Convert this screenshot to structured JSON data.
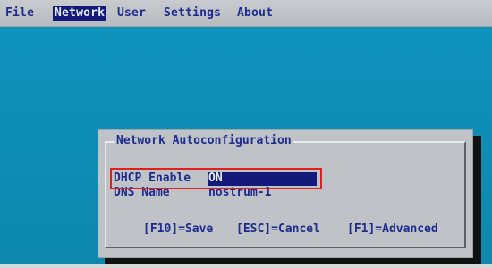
{
  "menu": {
    "items": [
      "File",
      "Network",
      "User",
      "Settings",
      "About"
    ],
    "active": "Network"
  },
  "dialog": {
    "title": "Network Autoconfiguration",
    "fields": [
      {
        "label": "DHCP Enable",
        "value": "ON"
      },
      {
        "label": "DNS Name",
        "value": "nostrum-1"
      }
    ],
    "keys": {
      "save": "[F10]=Save",
      "cancel": "[ESC]=Cancel",
      "advanced": "[F1]=Advanced"
    }
  },
  "colors": {
    "background": "#0f8fb8",
    "menubar": "#c0c4c8",
    "highlight": "#131a7a",
    "text": "#1d2b8f",
    "annotation": "#e0201c"
  }
}
